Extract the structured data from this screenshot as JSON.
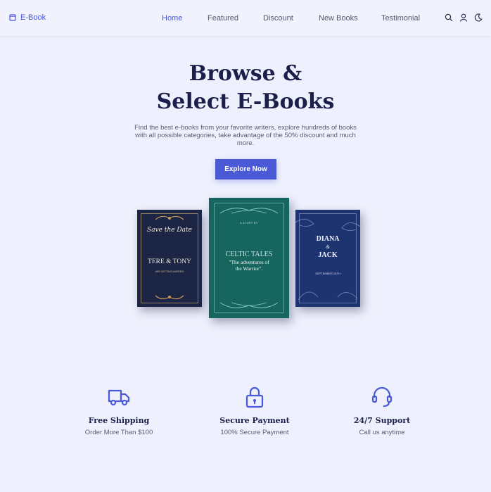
{
  "brand": {
    "name": "E-Book",
    "color": "#4756d4"
  },
  "nav": {
    "items": [
      {
        "label": "Home",
        "active": true
      },
      {
        "label": "Featured",
        "active": false
      },
      {
        "label": "Discount",
        "active": false
      },
      {
        "label": "New Books",
        "active": false
      },
      {
        "label": "Testimonial",
        "active": false
      }
    ],
    "icons": [
      "search-icon",
      "user-icon",
      "moon-icon"
    ]
  },
  "hero": {
    "title_line1": "Browse &",
    "title_line2": "Select E-Books",
    "description": "Find the best e-books from your favorite writers, explore hundreds of books with all possible categories, take advantage of the 50% discount and much more.",
    "cta_label": "Explore Now",
    "accent": "#4a5ad6"
  },
  "books": {
    "left": {
      "script": "Save the Date",
      "names": "TERE & TONY",
      "small": "ARE GETTING MARRIED"
    },
    "center": {
      "subtitle": "A STORY BY",
      "title": "CELTIC TALES",
      "quote_line1": "\"The adventures of",
      "quote_line2": "the Warrior\"."
    },
    "right": {
      "name1": "DIANA",
      "amp": "&",
      "name2": "JACK",
      "date": "SEPTEMBER 26TH"
    }
  },
  "features": [
    {
      "icon": "truck-icon",
      "title": "Free Shipping",
      "desc": "Order More Than $100"
    },
    {
      "icon": "lock-icon",
      "title": "Secure Payment",
      "desc": "100% Secure Payment"
    },
    {
      "icon": "headset-icon",
      "title": "24/7 Support",
      "desc": "Call us anytime"
    }
  ]
}
